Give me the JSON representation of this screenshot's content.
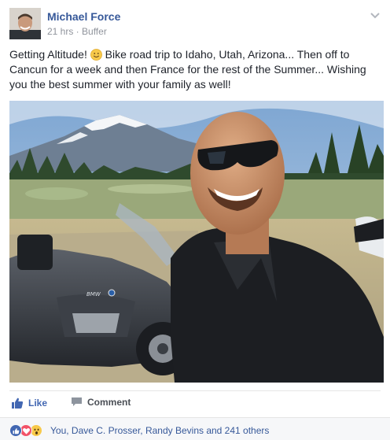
{
  "post": {
    "author": "Michael Force",
    "meta": "21 hrs · Buffer",
    "text_before_emoji": "Getting Altitude! ",
    "text_after_emoji": " Bike road trip to Idaho, Utah, Arizona... Then off to Cancun for a week and then France for the rest of the Summer... Wishing you the best summer with your family as well!"
  },
  "actions": {
    "like_label": "Like",
    "comment_label": "Comment"
  },
  "reactions": {
    "summary": "You, Dave C. Prosser, Randy Bevins and 241 others",
    "types": [
      "like",
      "love",
      "wow"
    ]
  },
  "colors": {
    "link": "#365899",
    "like_blue": "#4267b2",
    "love_red": "#f25268",
    "wow_yellow": "#f7c94a",
    "muted": "#90949c"
  }
}
